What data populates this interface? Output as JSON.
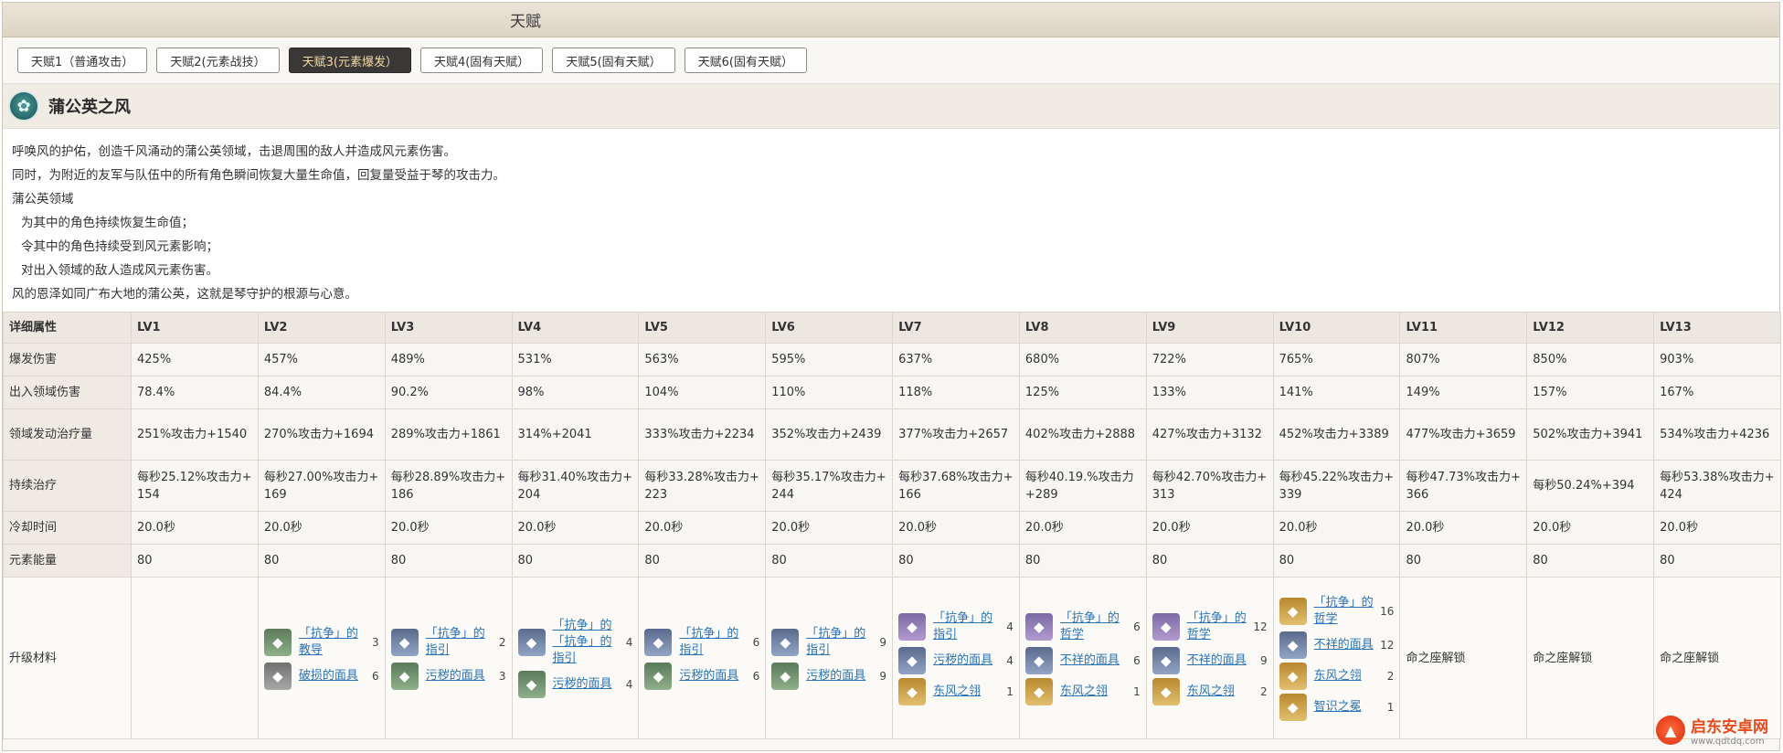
{
  "header": {
    "title": "天赋"
  },
  "tabs": [
    {
      "label": "天赋1（普通攻击）",
      "active": false
    },
    {
      "label": "天赋2(元素战技）",
      "active": false
    },
    {
      "label": "天赋3(元素爆发）",
      "active": true
    },
    {
      "label": "天赋4(固有天赋）",
      "active": false
    },
    {
      "label": "天赋5(固有天赋）",
      "active": false
    },
    {
      "label": "天赋6(固有天赋）",
      "active": false
    }
  ],
  "skill": {
    "icon": "dandelion-wind-icon",
    "name": "蒲公英之风",
    "desc": [
      "呼唤风的护佑，创造千风涌动的蒲公英领域，击退周围的敌人并造成风元素伤害。",
      "同时，为附近的友军与队伍中的所有角色瞬间恢复大量生命值，回复量受益于琴的攻击力。",
      "蒲公英领域",
      "为其中的角色持续恢复生命值；",
      "令其中的角色持续受到风元素影响；",
      "对出入领域的敌人造成风元素伤害。",
      "风的恩泽如同广布大地的蒲公英，这就是琴守护的根源与心意。"
    ]
  },
  "table": {
    "header": [
      "详细属性",
      "LV1",
      "LV2",
      "LV3",
      "LV4",
      "LV5",
      "LV6",
      "LV7",
      "LV8",
      "LV9",
      "LV10",
      "LV11",
      "LV12",
      "LV13"
    ],
    "rows": [
      [
        "爆发伤害",
        "425%",
        "457%",
        "489%",
        "531%",
        "563%",
        "595%",
        "637%",
        "680%",
        "722%",
        "765%",
        "807%",
        "850%",
        "903%"
      ],
      [
        "出入领域伤害",
        "78.4%",
        "84.4%",
        "90.2%",
        "98%",
        "104%",
        "110%",
        "118%",
        "125%",
        "133%",
        "141%",
        "149%",
        "157%",
        "167%"
      ],
      [
        "领域发动治疗量",
        "251%攻击力+1540",
        "270%攻击力+1694",
        "289%攻击力+1861",
        "314%+2041",
        "333%攻击力+2234",
        "352%攻击力+2439",
        "377%攻击力+2657",
        "402%攻击力+2888",
        "427%攻击力+3132",
        "452%攻击力+3389",
        "477%攻击力+3659",
        "502%攻击力+3941",
        "534%攻击力+4236"
      ],
      [
        "持续治疗",
        "每秒25.12%攻击力+154",
        "每秒27.00%攻击力+169",
        "每秒28.89%攻击力+186",
        "每秒31.40%攻击力+204",
        "每秒33.28%攻击力+223",
        "每秒35.17%攻击力+244",
        "每秒37.68%攻击力+166",
        "每秒40.19.%攻击力+289",
        "每秒42.70%攻击力+313",
        "每秒45.22%攻击力+339",
        "每秒47.73%攻击力+366",
        "每秒50.24%+394",
        "每秒53.38%攻击力+424"
      ],
      [
        "冷却时间",
        "20.0秒",
        "20.0秒",
        "20.0秒",
        "20.0秒",
        "20.0秒",
        "20.0秒",
        "20.0秒",
        "20.0秒",
        "20.0秒",
        "20.0秒",
        "20.0秒",
        "20.0秒",
        "20.0秒"
      ],
      [
        "元素能量",
        "80",
        "80",
        "80",
        "80",
        "80",
        "80",
        "80",
        "80",
        "80",
        "80",
        "80",
        "80",
        "80"
      ]
    ],
    "materials_label": "升级材料",
    "materials": [
      [],
      [
        {
          "name": "「抗争」的教导",
          "count": "3",
          "color": "green"
        },
        {
          "name": "破损的面具",
          "count": "6",
          "color": "gray"
        }
      ],
      [
        {
          "name": "「抗争」的指引",
          "count": "2",
          "color": "blue"
        },
        {
          "name": "污秽的面具",
          "count": "3",
          "color": "green"
        }
      ],
      [
        {
          "name": "「抗争」的「抗争」的指引",
          "count": "4",
          "color": "blue"
        },
        {
          "name": "污秽的面具",
          "count": "4",
          "color": "green"
        }
      ],
      [
        {
          "name": "「抗争」的指引",
          "count": "6",
          "color": "blue"
        },
        {
          "name": "污秽的面具",
          "count": "6",
          "color": "green"
        }
      ],
      [
        {
          "name": "「抗争」的指引",
          "count": "9",
          "color": "blue"
        },
        {
          "name": "污秽的面具",
          "count": "9",
          "color": "green"
        }
      ],
      [
        {
          "name": "「抗争」的指引",
          "count": "4",
          "color": "purple"
        },
        {
          "name": "污秽的面具",
          "count": "4",
          "color": "blue"
        },
        {
          "name": "东风之翎",
          "count": "1",
          "color": "gold"
        }
      ],
      [
        {
          "name": "「抗争」的哲学",
          "count": "6",
          "color": "purple"
        },
        {
          "name": "不祥的面具",
          "count": "6",
          "color": "blue"
        },
        {
          "name": "东风之翎",
          "count": "1",
          "color": "gold"
        }
      ],
      [
        {
          "name": "「抗争」的哲学",
          "count": "12",
          "color": "purple"
        },
        {
          "name": "不祥的面具",
          "count": "9",
          "color": "blue"
        },
        {
          "name": "东风之翎",
          "count": "2",
          "color": "gold"
        }
      ],
      [
        {
          "name": "「抗争」的哲学",
          "count": "16",
          "color": "gold"
        },
        {
          "name": "不祥的面具",
          "count": "12",
          "color": "blue"
        },
        {
          "name": "东风之翎",
          "count": "2",
          "color": "gold"
        },
        {
          "name": "智识之冕",
          "count": "1",
          "color": "gold"
        }
      ],
      "命之座解锁",
      "命之座解锁",
      "命之座解锁"
    ]
  },
  "watermark": {
    "name": "启东安卓网",
    "url": "www.qdtdq.com"
  }
}
